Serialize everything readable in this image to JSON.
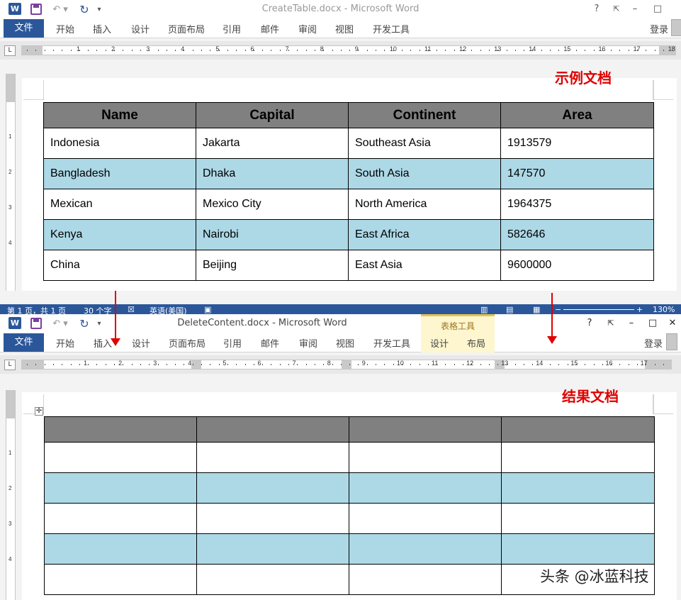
{
  "window1": {
    "title": "CreateTable.docx - Microsoft Word",
    "caption": "示例文档",
    "table": {
      "headers": [
        "Name",
        "Capital",
        "Continent",
        "Area"
      ],
      "rows": [
        [
          "Indonesia",
          "Jakarta",
          "Southeast Asia",
          "1913579"
        ],
        [
          "Bangladesh",
          "Dhaka",
          "South Asia",
          "147570"
        ],
        [
          "Mexican",
          "Mexico City",
          "North America",
          "1964375"
        ],
        [
          "Kenya",
          "Nairobi",
          "East Africa",
          "582646"
        ],
        [
          "China",
          "Beijing",
          "East Asia",
          "9600000"
        ]
      ]
    },
    "status": {
      "page": "第 1 页，共 1 页",
      "words": "30 个字",
      "language": "英语(美国)",
      "zoom": "130%"
    }
  },
  "window2": {
    "title": "DeleteContent.docx - Microsoft Word",
    "caption": "结果文档",
    "table_tools": "表格工具",
    "context_tabs": [
      "设计",
      "布局"
    ],
    "table_row_count": 5,
    "table_col_count": 4
  },
  "ribbon": {
    "file": "文件",
    "tabs": [
      "开始",
      "插入",
      "设计",
      "页面布局",
      "引用",
      "邮件",
      "审阅",
      "视图",
      "开发工具"
    ],
    "login": "登录"
  },
  "window_controls": {
    "help": "?",
    "minimize": "–",
    "maximize": "□",
    "close": "✕"
  },
  "ruler": {
    "numbers": [
      "1",
      "2",
      "3",
      "4",
      "5",
      "6",
      "7",
      "8",
      "9",
      "10",
      "11",
      "12",
      "13",
      "14",
      "15",
      "16",
      "17",
      "18"
    ],
    "numbers2": [
      "1",
      "2",
      "3",
      "4",
      "5",
      "6",
      "7",
      "8",
      "9",
      "10",
      "11",
      "12",
      "13",
      "14",
      "15",
      "16",
      "17"
    ],
    "vertical": [
      "1",
      "2",
      "3",
      "4"
    ]
  },
  "watermark": "头条 @冰蓝科技",
  "colors": {
    "word_blue": "#2b579a",
    "header_gray": "#808080",
    "alt_row": "#add8e6",
    "caption_red": "#e00000"
  }
}
